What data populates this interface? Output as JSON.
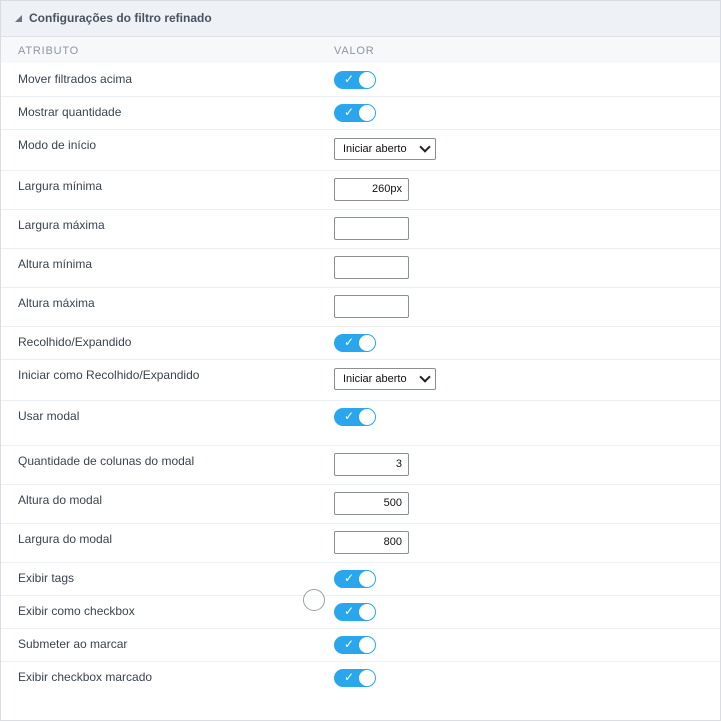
{
  "panel": {
    "title": "Configurações do filtro refinado",
    "columns": {
      "attribute": "ATRIBUTO",
      "value": "VALOR"
    }
  },
  "rows": [
    {
      "label": "Mover filtrados acima",
      "type": "toggle",
      "checked": true
    },
    {
      "label": "Mostrar quantidade",
      "type": "toggle",
      "checked": true
    },
    {
      "label": "Modo de início",
      "type": "select",
      "selected": "Iniciar aberto"
    },
    {
      "label": "Largura mínima",
      "type": "input",
      "value": "260px"
    },
    {
      "label": "Largura máxima",
      "type": "input",
      "value": ""
    },
    {
      "label": "Altura mínima",
      "type": "input",
      "value": ""
    },
    {
      "label": "Altura máxima",
      "type": "input",
      "value": ""
    },
    {
      "label": "Recolhido/Expandido",
      "type": "toggle",
      "checked": true
    },
    {
      "label": "Iniciar como Recolhido/Expandido",
      "type": "select",
      "selected": "Iniciar aberto"
    },
    {
      "label": "Usar modal",
      "type": "toggle",
      "checked": true
    },
    {
      "label": "Quantidade de colunas do modal",
      "type": "input",
      "value": "3"
    },
    {
      "label": "Altura do modal",
      "type": "input",
      "value": "500"
    },
    {
      "label": "Largura do modal",
      "type": "input",
      "value": "800"
    },
    {
      "label": "Exibir tags",
      "type": "toggle",
      "checked": true
    },
    {
      "label": "Exibir como checkbox",
      "type": "toggle",
      "checked": true
    },
    {
      "label": "Submeter ao marcar",
      "type": "toggle",
      "checked": true
    },
    {
      "label": "Exibir checkbox marcado",
      "type": "toggle",
      "checked": true
    }
  ],
  "icons": {
    "collapse": "caret-icon",
    "toggle_check": "check-icon",
    "select_arrow": "chevron-down-icon"
  },
  "colors": {
    "toggle_on": "#2aa7ec",
    "header_bg": "#eef1f5"
  }
}
